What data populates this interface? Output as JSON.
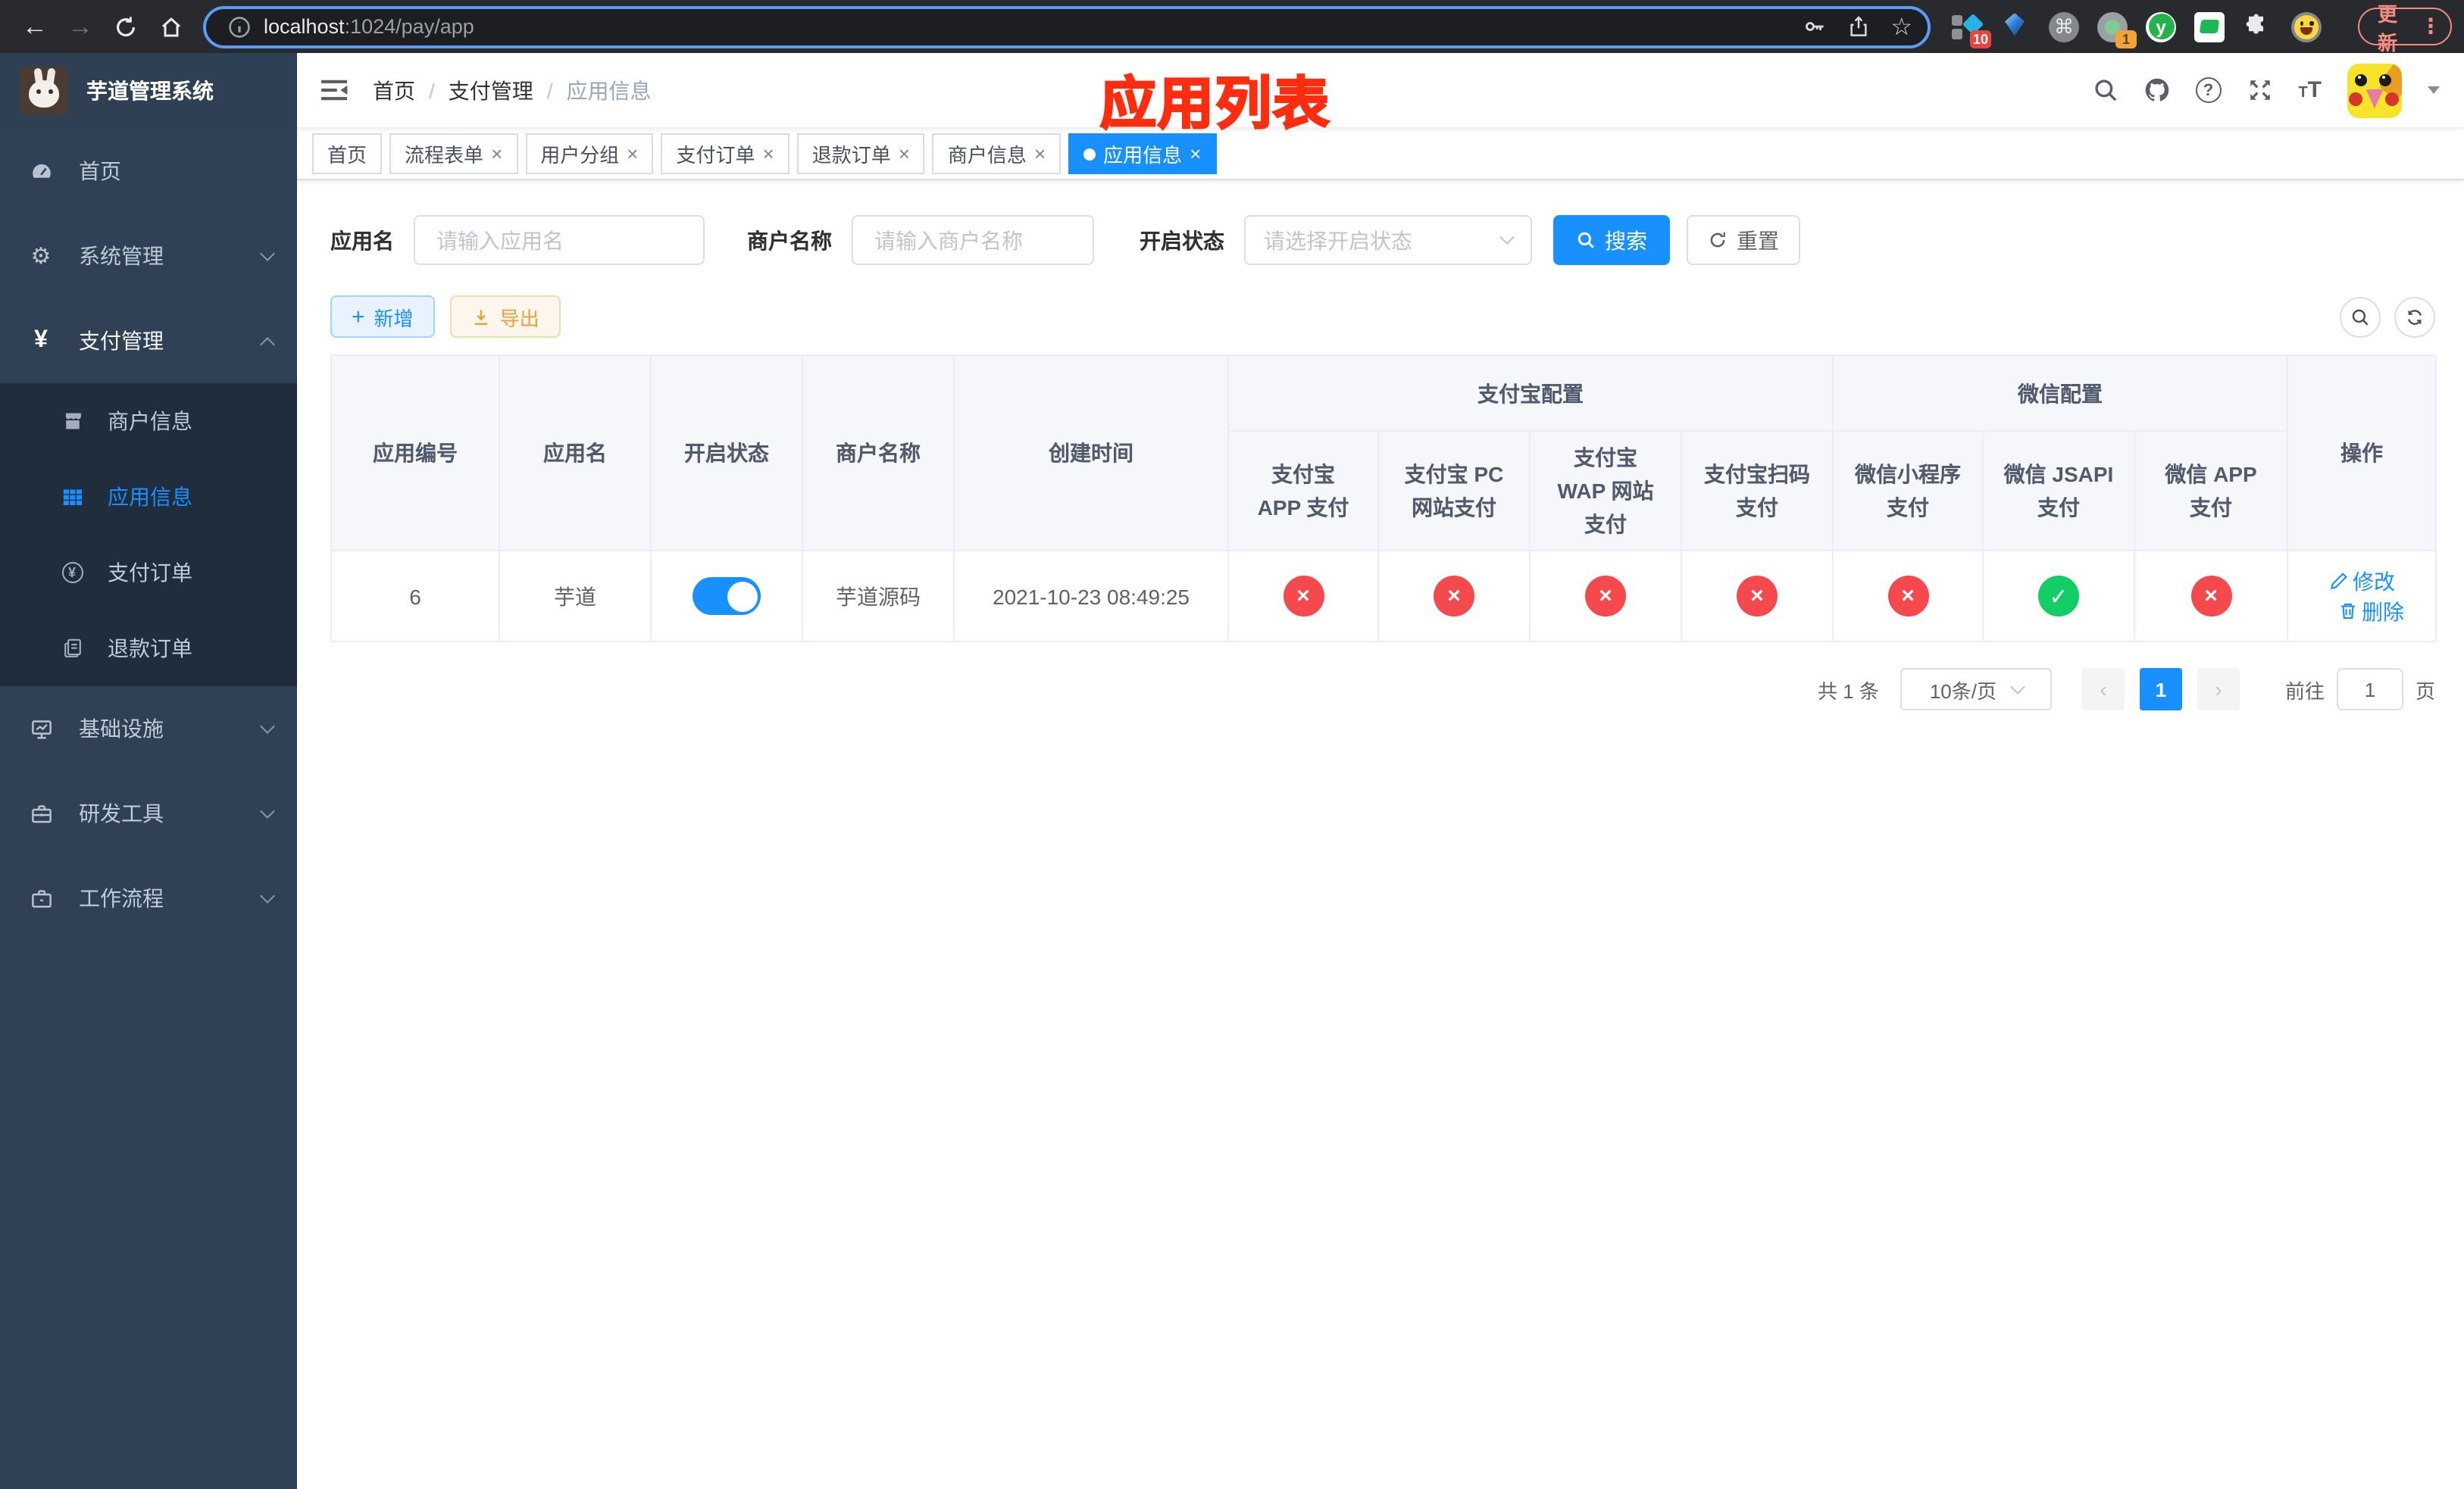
{
  "browser": {
    "url": {
      "host": "localhost",
      "path": ":1024/pay/app"
    },
    "ext_badge_translate": "10",
    "ext_badge_capture": "1",
    "ext_y_label": "y",
    "update_label": "更新"
  },
  "sidebar": {
    "title": "芋道管理系统",
    "menu_home": "首页",
    "menu_system": "系统管理",
    "menu_pay": "支付管理",
    "sub_merchant": "商户信息",
    "sub_app": "应用信息",
    "sub_pay_order": "支付订单",
    "sub_refund_order": "退款订单",
    "menu_infra": "基础设施",
    "menu_dev_tools": "研发工具",
    "menu_workflow": "工作流程"
  },
  "navbar": {
    "breadcrumb": [
      "首页",
      "支付管理",
      "应用信息"
    ],
    "annotation": "应用列表"
  },
  "tabs": [
    {
      "label": "首页"
    },
    {
      "label": "流程表单"
    },
    {
      "label": "用户分组"
    },
    {
      "label": "支付订单"
    },
    {
      "label": "退款订单"
    },
    {
      "label": "商户信息"
    },
    {
      "label": "应用信息"
    }
  ],
  "filters": {
    "app_name_label": "应用名",
    "app_name_placeholder": "请输入应用名",
    "merchant_label": "商户名称",
    "merchant_placeholder": "请输入商户名称",
    "status_label": "开启状态",
    "status_placeholder": "请选择开启状态",
    "search_label": "搜索",
    "reset_label": "重置"
  },
  "toolbar": {
    "add_label": "新增",
    "export_label": "导出"
  },
  "table": {
    "headers": {
      "id": "应用编号",
      "name": "应用名",
      "enabled": "开启状态",
      "merchant": "商户名称",
      "created": "创建时间",
      "alipay_group": "支付宝配置",
      "wechat_group": "微信配置",
      "alipay_app": "支付宝 APP 支付",
      "alipay_pc": "支付宝 PC 网站支付",
      "alipay_wap": "支付宝 WAP 网站支付",
      "alipay_qr": "支付宝扫码支付",
      "wx_lite": "微信小程序支付",
      "wx_jsapi": "微信 JSAPI 支付",
      "wx_app": "微信 APP 支付",
      "actions": "操作"
    },
    "row": {
      "id": "6",
      "name": "芋道",
      "enabled": true,
      "merchant": "芋道源码",
      "created": "2021-10-23 08:49:25",
      "statuses": [
        false,
        false,
        false,
        false,
        false,
        true,
        false
      ],
      "edit_label": "修改",
      "delete_label": "删除"
    }
  },
  "pagination": {
    "total": "共 1 条",
    "page_size": "10条/页",
    "current_page": "1",
    "goto_label": "前往",
    "goto_value": "1",
    "page_unit": "页"
  },
  "colors": {
    "accent": "#1890ff",
    "danger": "#f5494e",
    "success": "#13ce66",
    "annotation_red": "#ff2d0f",
    "sidebar_bg": "#304156",
    "submenu_bg": "#1f2d3d"
  }
}
